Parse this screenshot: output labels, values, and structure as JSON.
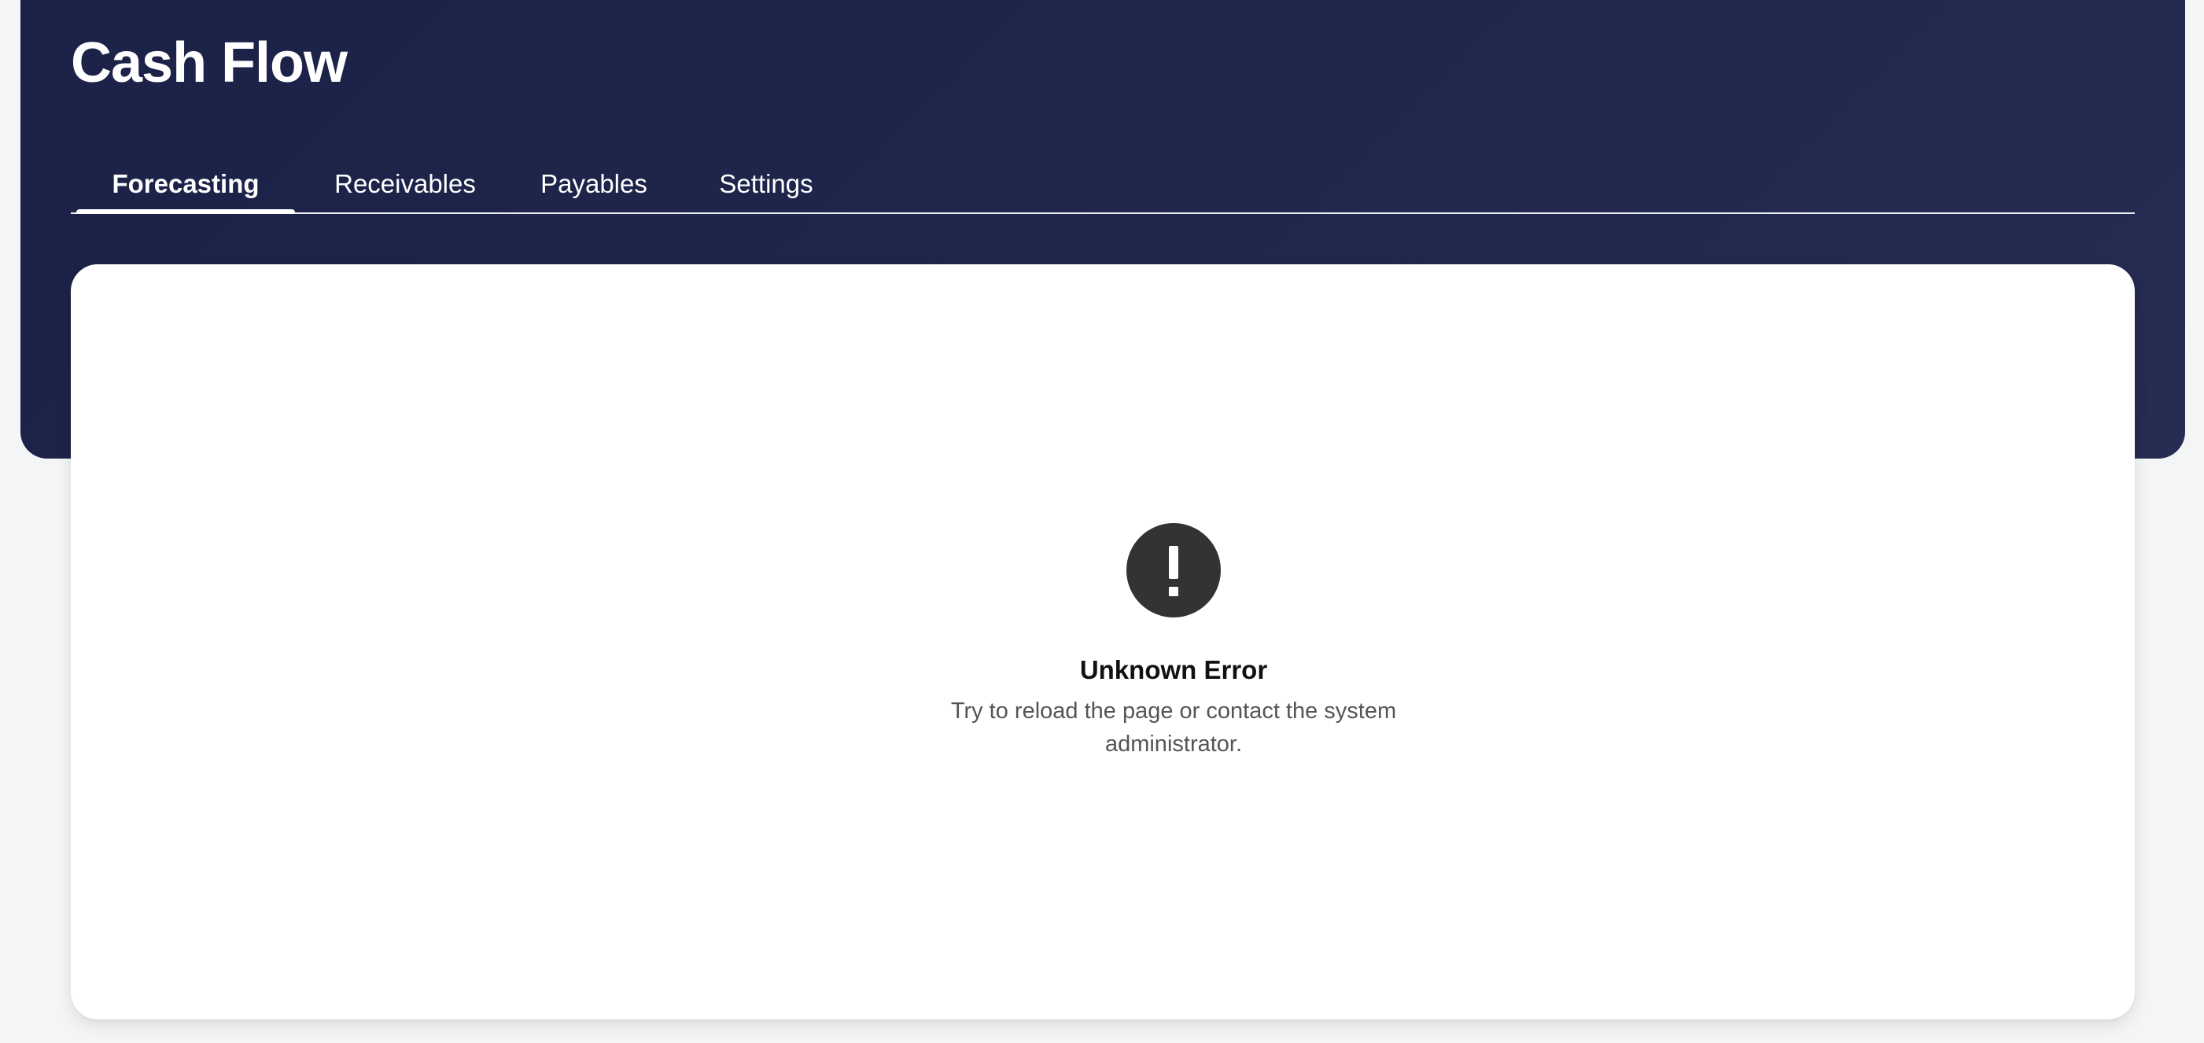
{
  "header": {
    "title": "Cash Flow"
  },
  "tabs": [
    {
      "label": "Forecasting",
      "active": true
    },
    {
      "label": "Receivables",
      "active": false
    },
    {
      "label": "Payables",
      "active": false
    },
    {
      "label": "Settings",
      "active": false
    }
  ],
  "error_state": {
    "icon": "exclamation-icon",
    "title": "Unknown Error",
    "message": "Try to reload the page or contact the system administrator."
  },
  "colors": {
    "header_background": "#1e2449",
    "card_background": "#ffffff",
    "error_icon_background": "#333333",
    "page_background": "#f4f5f7"
  }
}
